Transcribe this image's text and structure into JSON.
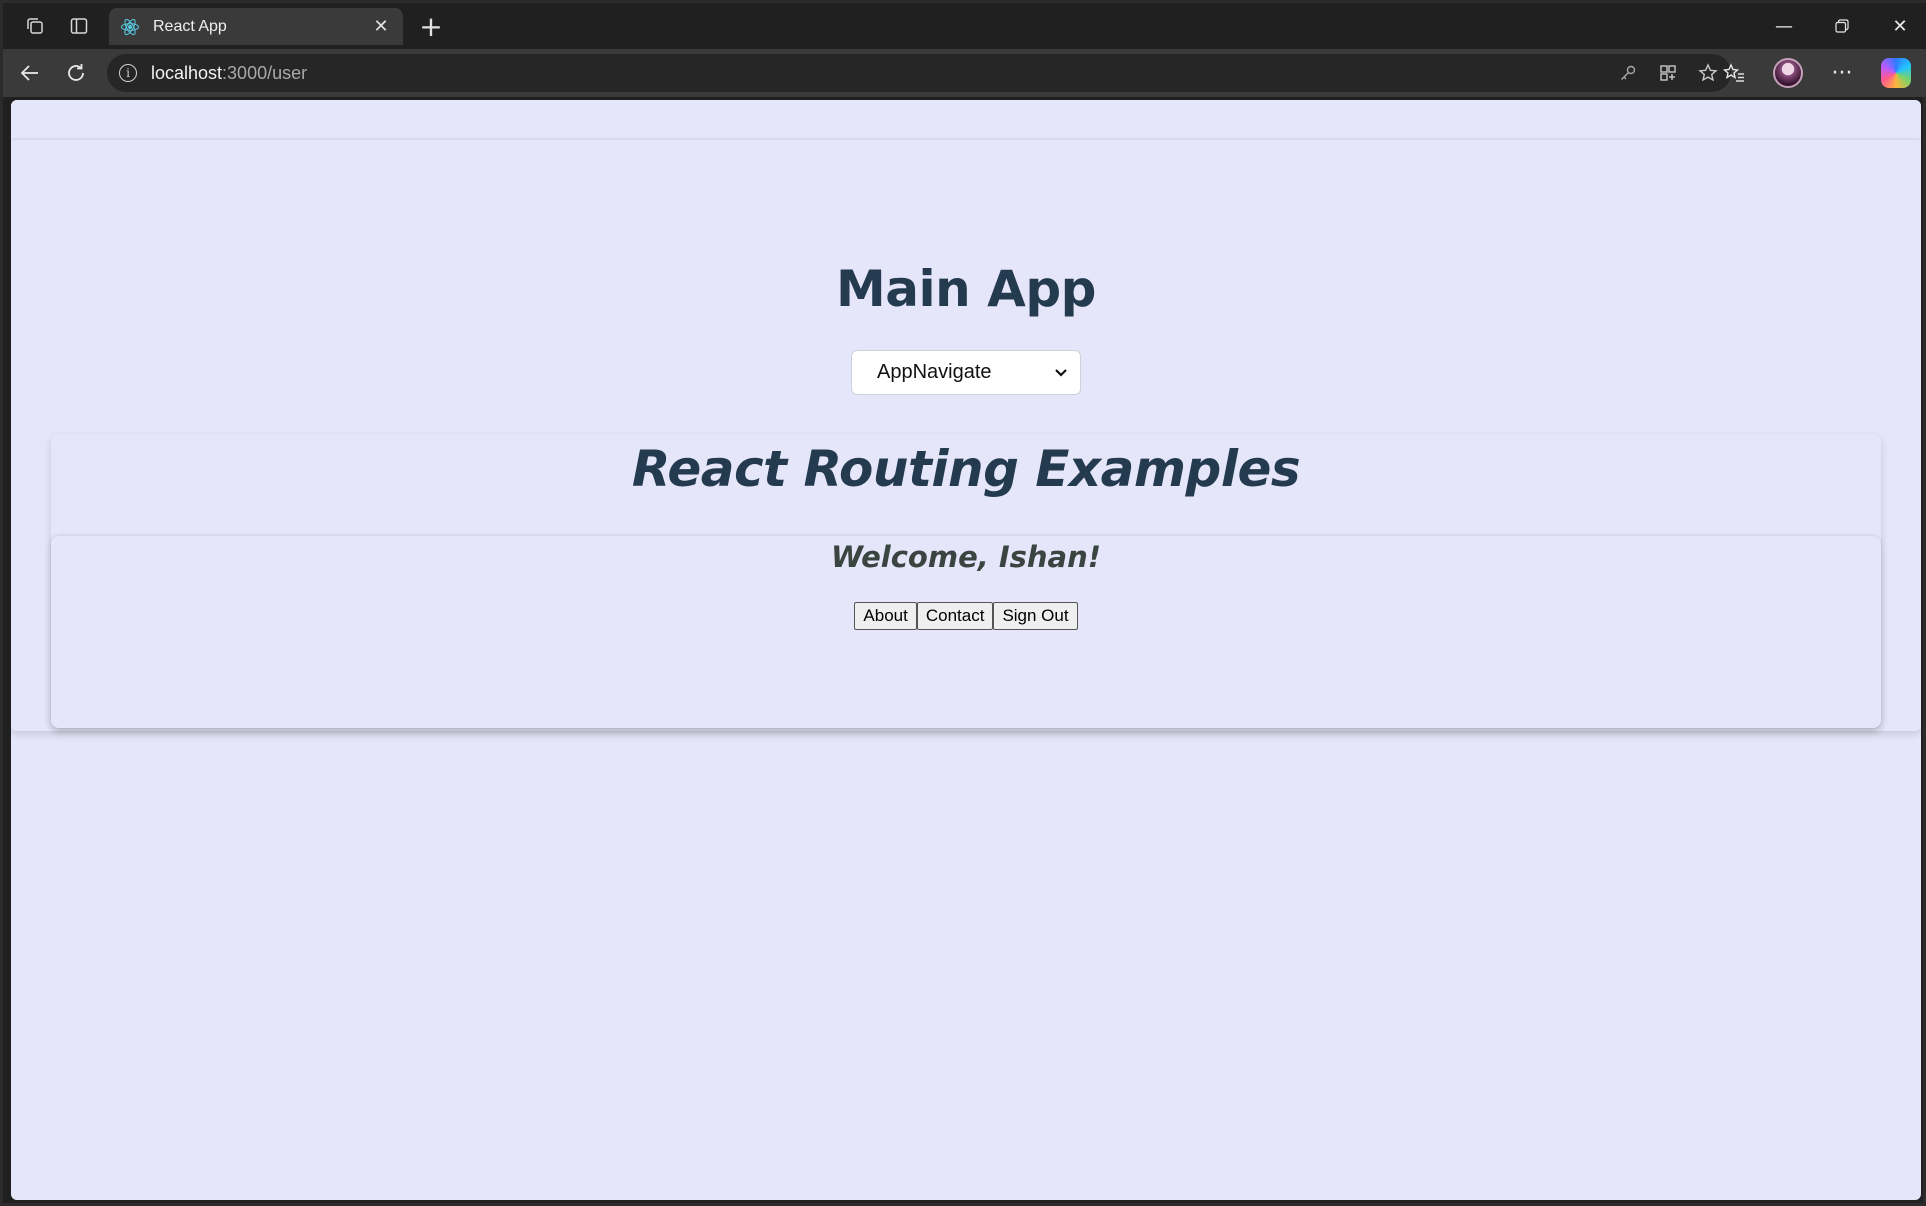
{
  "browser": {
    "tab_title": "React App",
    "url_host": "localhost",
    "url_path": ":3000/user",
    "icons": {
      "workspaces": "workspaces-icon",
      "tab_actions": "tab-actions-icon",
      "react_favicon": "react-icon",
      "close_tab": "close-icon",
      "new_tab": "plus-icon",
      "minimize": "minimize-icon",
      "restore": "restore-icon",
      "close_window": "close-window-icon",
      "back": "back-arrow-icon",
      "refresh": "refresh-icon",
      "site_info": "info-icon",
      "password": "key-icon",
      "app_available": "apps-icon",
      "favorite": "star-icon",
      "favorites": "favorites-icon",
      "profile": "avatar",
      "more": "more-icon",
      "copilot": "copilot-icon"
    }
  },
  "app": {
    "title": "Main App",
    "navigate_select": {
      "selected": "AppNavigate"
    },
    "routing_title": "React Routing Examples",
    "welcome": "Welcome, Ishan!",
    "buttons": {
      "about": "About",
      "contact": "Contact",
      "sign_out": "Sign Out"
    }
  },
  "colors": {
    "page_bg": "#e6e6fa",
    "heading": "#243b4f",
    "welcome_text": "#3a4440"
  }
}
